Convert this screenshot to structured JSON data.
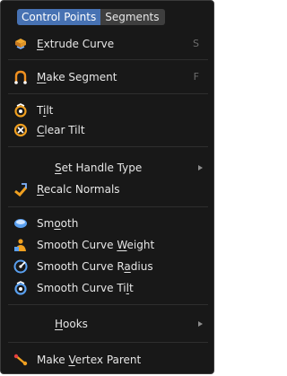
{
  "tabs": [
    {
      "label": "Control Points",
      "active": true
    },
    {
      "label": "Segments",
      "active": false
    }
  ],
  "items": [
    {
      "label": "Extrude Curve",
      "mnemonic_index": 0,
      "shortcut": "S",
      "icon": "extrude-icon"
    },
    {
      "label": "Make Segment",
      "mnemonic_index": 0,
      "shortcut": "F",
      "icon": "make-segment-icon"
    },
    {
      "label": "Tilt",
      "mnemonic_index": 1,
      "icon": "tilt-icon"
    },
    {
      "label": "Clear Tilt",
      "mnemonic_index": 0,
      "icon": "clear-tilt-icon"
    },
    {
      "label": "Set Handle Type",
      "mnemonic_index": 0,
      "submenu": true
    },
    {
      "label": "Recalc Normals",
      "mnemonic_index": 0,
      "icon": "recalc-normals-icon"
    },
    {
      "label": "Smooth",
      "mnemonic_index": 2,
      "icon": "smooth-icon"
    },
    {
      "label": "Smooth Curve Weight",
      "mnemonic_index": 13,
      "icon": "smooth-weight-icon"
    },
    {
      "label": "Smooth Curve Radius",
      "mnemonic_index": 14,
      "icon": "smooth-radius-icon"
    },
    {
      "label": "Smooth Curve Tilt",
      "mnemonic_index": 15,
      "icon": "smooth-tilt-icon"
    },
    {
      "label": "Hooks",
      "mnemonic_index": 0,
      "submenu": true
    },
    {
      "label": "Make Vertex Parent",
      "mnemonic_index": 5,
      "icon": "vertex-parent-icon"
    }
  ],
  "colors": {
    "menu_bg": "#181818",
    "tab_active": "#4772b3",
    "tab_inactive": "#3e3e3e",
    "text": "#e6e6e6",
    "shortcut": "#6c6c6c"
  }
}
